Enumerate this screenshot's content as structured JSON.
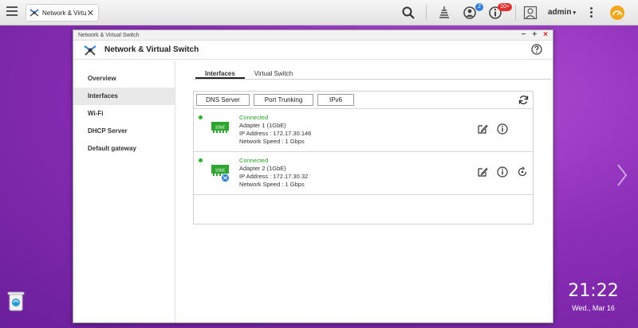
{
  "taskbar": {
    "tab_label": "Network & Virtu...",
    "notifications_badge": "2",
    "events_badge": "10+",
    "user_label": "admin",
    "user_caret": "▾"
  },
  "window": {
    "title": "Network & Virtual Switch",
    "app_title": "Network & Virtual Switch",
    "controls": {
      "minimize": "−",
      "maximize": "+",
      "close": "×"
    }
  },
  "sidebar": {
    "items": [
      {
        "label": "Overview"
      },
      {
        "label": "Interfaces"
      },
      {
        "label": "Wi-Fi"
      },
      {
        "label": "DHCP Server"
      },
      {
        "label": "Default gateway"
      }
    ],
    "active_index": 1
  },
  "tabs": [
    {
      "label": "Interfaces"
    },
    {
      "label": "Virtual Switch"
    }
  ],
  "toolbar": {
    "dns_label": "DNS Server",
    "trunk_label": "Port Trunking",
    "ipv6_label": "IPv6"
  },
  "adapters": [
    {
      "status": "Connected",
      "name": "Adapter 1 (1GbE)",
      "ip": "IP Address : 172.17.30.146",
      "speed": "Network Speed : 1 Gbps",
      "nic_label": "1GbE"
    },
    {
      "status": "Connected",
      "name": "Adapter 2 (1GbE)",
      "ip": "IP Address : 172.17.30.32",
      "speed": "Network Speed : 1 Gbps",
      "nic_label": "1GbE"
    }
  ],
  "clock": {
    "time": "21:22",
    "date": "Wed., Mar 16"
  },
  "colors": {
    "connected": "#28a428",
    "accent_blue": "#2f7fd8",
    "badge_red": "#e23030",
    "desktop_purple": "#8d2fb8"
  }
}
